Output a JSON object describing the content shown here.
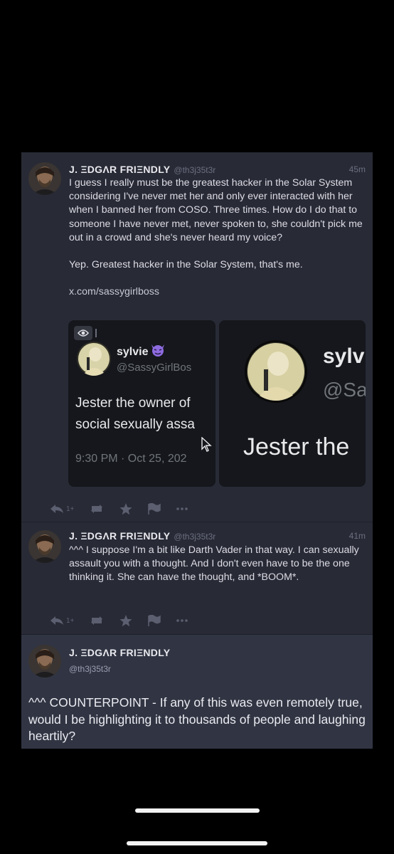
{
  "posts": [
    {
      "display_name": "J. ΞDGΛR FRIΞNDLY",
      "acct": "@th3j35t3r",
      "time": "45m",
      "paragraphs": [
        "I guess I really must be the greatest hacker in the Solar System considering I've never met her and only ever interacted with her when I banned her from COSO. Three times. How do I do that to someone I have never met, never spoken to, she couldn't pick me out in a crowd and she's never heard my voice?",
        "Yep. Greatest hacker in the Solar System, that's me."
      ],
      "link": "x.com/sassygirlboss",
      "media": {
        "card1": {
          "name": "sylvie",
          "handle": "@SassyGirlBos",
          "text_line1": "Jester the owner of",
          "text_line2": "social sexually assa",
          "date": "9:30 PM · Oct 25, 202"
        },
        "card2": {
          "name": "sylv",
          "handle": "@Sa",
          "text": "Jester the"
        }
      },
      "actions": {
        "reply_count": "1+"
      }
    },
    {
      "display_name": "J. ΞDGΛR FRIΞNDLY",
      "acct": "@th3j35t3r",
      "time": "41m",
      "text": "^^^ I suppose I'm a bit like Darth Vader in that way. I can sexually assault you with a thought. And I don't even have to be the one thinking it. She can have the thought, and *BOOM*.",
      "actions": {
        "reply_count": "1+"
      }
    },
    {
      "display_name": "J. ΞDGΛR FRIΞNDLY",
      "acct": "@th3j35t3r",
      "text": "^^^ COUNTERPOINT - If any of this was even remotely true, would I be highlighting it to thousands of people and laughing heartily?"
    }
  ],
  "icons": [
    "reply-icon",
    "boost-icon",
    "star-icon",
    "flag-icon",
    "more-icon",
    "eye-icon",
    "devil-emoji-icon",
    "cursor-icon"
  ],
  "colors": {
    "panel": "#282a36",
    "focused": "#313543",
    "muted": "#6c6f80",
    "purple": "#7b5cd6"
  }
}
